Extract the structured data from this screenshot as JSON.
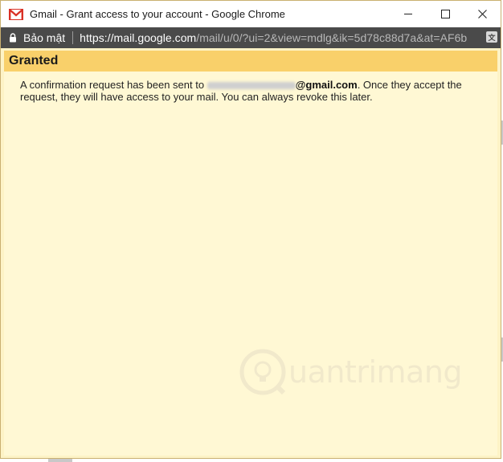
{
  "window": {
    "title": "Gmail - Grant access to your account - Google Chrome",
    "brand_color": "#d93025"
  },
  "address_bar": {
    "security_label": "Bảo mật",
    "url_host": "https://mail.google.com",
    "url_path": "/mail/u/0/?ui=2&view=mdlg&ik=5d78c88d7a&at=AF6b"
  },
  "dialog": {
    "heading": "Granted",
    "message_prefix": "A confirmation request has been sent to ",
    "email_domain": "@gmail.com",
    "message_suffix": ". Once they accept the request, they will have access to your mail. You can always revoke this later."
  },
  "watermark": {
    "text": "uantrimang"
  },
  "colors": {
    "header_bg": "#f9d06a",
    "body_bg": "#fff8d4",
    "address_bar_bg": "#4a4a4a"
  }
}
